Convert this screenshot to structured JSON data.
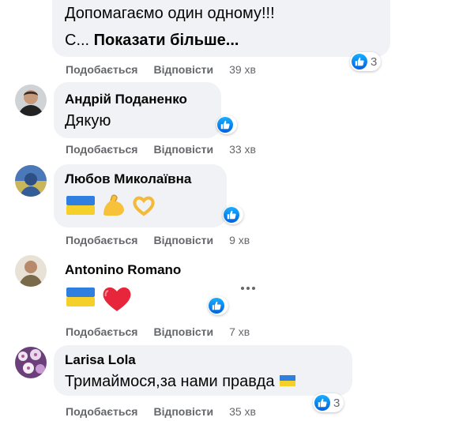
{
  "colors": {
    "bubble": "#f0f2f5",
    "like_blue": "#1877f2",
    "meta_gray": "#65676b"
  },
  "actions": {
    "like": "Подобається",
    "reply": "Відповісти"
  },
  "comments": [
    {
      "author": "",
      "lines": [
        "Допомагаємо один одному!!!"
      ],
      "truncated_prefix": "С... ",
      "more_label": "Показати більше...",
      "time": "39 хв",
      "reaction_count": "3",
      "reaction_icon": "like-icon"
    },
    {
      "author": "Андрій Поданенко",
      "text": "Дякую",
      "time": "33 хв",
      "reaction_icon": "like-icon"
    },
    {
      "author": "Любов Миколаївна",
      "emojis": [
        "ukraine-flag-emoji",
        "flexed-biceps-emoji",
        "heart-hands-emoji"
      ],
      "time": "9 хв",
      "reaction_icon": "like-icon"
    },
    {
      "author": "Antonino Romano",
      "emojis": [
        "ukraine-flag-emoji",
        "red-heart-emoji"
      ],
      "time": "7 хв",
      "reaction_icon": "like-icon",
      "options_icon": "more-options-icon"
    },
    {
      "author": "Larisa Lola",
      "text": "Тримаймося,за нами правда",
      "text_emoji": "ukraine-flag-emoji",
      "time": "35 хв",
      "reaction_count": "3",
      "reaction_icon": "like-icon"
    }
  ]
}
